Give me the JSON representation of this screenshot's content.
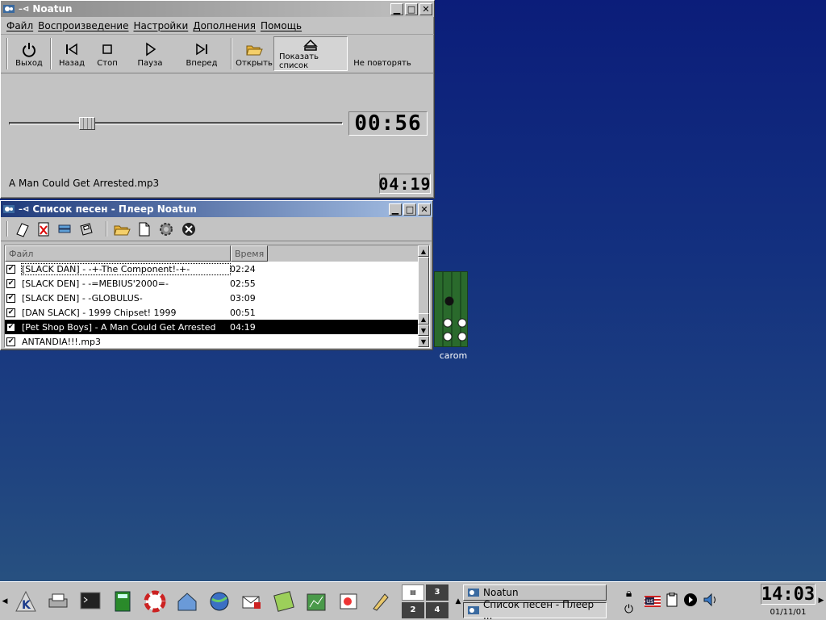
{
  "colors": {
    "desktop_top": "#0b1d7a",
    "desktop_bottom": "#2a5580",
    "panel": "#c3c3c3",
    "selection": "#000000"
  },
  "desktop": {
    "icon_label": "carom"
  },
  "noatun": {
    "title": "Noatun",
    "menu": [
      "Файл",
      "Воспроизведение",
      "Настройки",
      "Дополнения",
      "Помощь"
    ],
    "toolbar": {
      "exit": "Выход",
      "back": "Назад",
      "stop": "Стоп",
      "pause": "Пауза",
      "forward": "Вперед",
      "open": "Открыть",
      "show_list": "Показать список",
      "no_repeat": "Не повторять"
    },
    "elapsed": "00:56",
    "total": "04:19",
    "position_fraction": 0.22,
    "track_file": "A Man Could Get Arrested.mp3"
  },
  "playlist": {
    "title": "Список песен - Плеер Noatun",
    "columns": [
      "Файл",
      "Время"
    ],
    "rows": [
      {
        "file": "[SLACK DAN] - -+-The Component!-+-",
        "time": "02:24",
        "checked": true,
        "selected": false
      },
      {
        "file": "[SLACK DEN] - -=MEBIUS'2000=-",
        "time": "02:55",
        "checked": true,
        "selected": false
      },
      {
        "file": "[SLACK DEN] - -GLOBULUS-",
        "time": "03:09",
        "checked": true,
        "selected": false
      },
      {
        "file": "[DAN SLACK] - 1999 Chipset! 1999",
        "time": "00:51",
        "checked": true,
        "selected": false
      },
      {
        "file": "[Pet Shop Boys] - A Man Could Get Arrested",
        "time": "04:19",
        "checked": true,
        "selected": true
      },
      {
        "file": "ANTANDIA!!!.mp3",
        "time": "",
        "checked": true,
        "selected": false
      }
    ]
  },
  "taskbar": {
    "pager": [
      "1",
      "3",
      "2",
      "4"
    ],
    "tasks": [
      "Noatun",
      "Список песен - Плеер ..."
    ],
    "keyboard_layout": "us",
    "clock_time": "14:03",
    "clock_date": "01/11/01"
  }
}
